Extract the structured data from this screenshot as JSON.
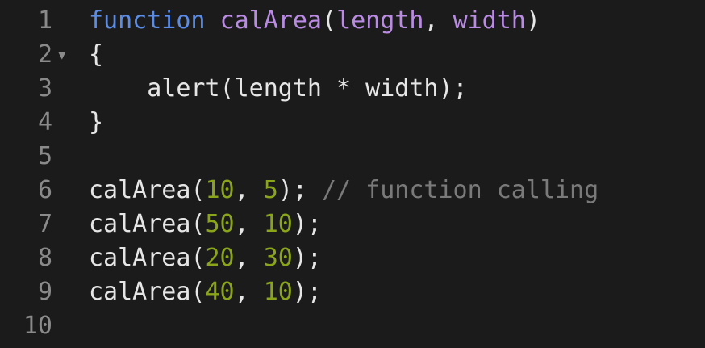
{
  "lines": [
    {
      "number": "1",
      "tokens": [
        {
          "t": "function",
          "c": "kw"
        },
        {
          "t": " ",
          "c": "plain"
        },
        {
          "t": "calArea",
          "c": "fn"
        },
        {
          "t": "(",
          "c": "plain"
        },
        {
          "t": "length",
          "c": "param"
        },
        {
          "t": ", ",
          "c": "plain"
        },
        {
          "t": "width",
          "c": "param"
        },
        {
          "t": ")",
          "c": "plain"
        }
      ]
    },
    {
      "number": "2",
      "fold": "▼",
      "tokens": [
        {
          "t": "{",
          "c": "plain"
        }
      ]
    },
    {
      "number": "3",
      "tokens": [
        {
          "t": "    alert(length * width);",
          "c": "plain"
        }
      ]
    },
    {
      "number": "4",
      "tokens": [
        {
          "t": "}",
          "c": "plain"
        }
      ]
    },
    {
      "number": "5",
      "tokens": []
    },
    {
      "number": "6",
      "tokens": [
        {
          "t": "calArea(",
          "c": "plain"
        },
        {
          "t": "10",
          "c": "num"
        },
        {
          "t": ", ",
          "c": "plain"
        },
        {
          "t": "5",
          "c": "num"
        },
        {
          "t": "); ",
          "c": "plain"
        },
        {
          "t": "// function calling",
          "c": "cmt"
        }
      ]
    },
    {
      "number": "7",
      "tokens": [
        {
          "t": "calArea(",
          "c": "plain"
        },
        {
          "t": "50",
          "c": "num"
        },
        {
          "t": ", ",
          "c": "plain"
        },
        {
          "t": "10",
          "c": "num"
        },
        {
          "t": ");",
          "c": "plain"
        }
      ]
    },
    {
      "number": "8",
      "tokens": [
        {
          "t": "calArea(",
          "c": "plain"
        },
        {
          "t": "20",
          "c": "num"
        },
        {
          "t": ", ",
          "c": "plain"
        },
        {
          "t": "30",
          "c": "num"
        },
        {
          "t": ");",
          "c": "plain"
        }
      ]
    },
    {
      "number": "9",
      "tokens": [
        {
          "t": "calArea(",
          "c": "plain"
        },
        {
          "t": "40",
          "c": "num"
        },
        {
          "t": ", ",
          "c": "plain"
        },
        {
          "t": "10",
          "c": "num"
        },
        {
          "t": ");",
          "c": "plain"
        }
      ]
    },
    {
      "number": "10",
      "tokens": []
    }
  ],
  "colors": {
    "background": "#1b1b1b",
    "keyword": "#5b8ce6",
    "function_name": "#b98be2",
    "number": "#8aa51a",
    "comment": "#7a7a7a",
    "text": "#e6e6e6",
    "gutter": "#8a8a8a"
  }
}
